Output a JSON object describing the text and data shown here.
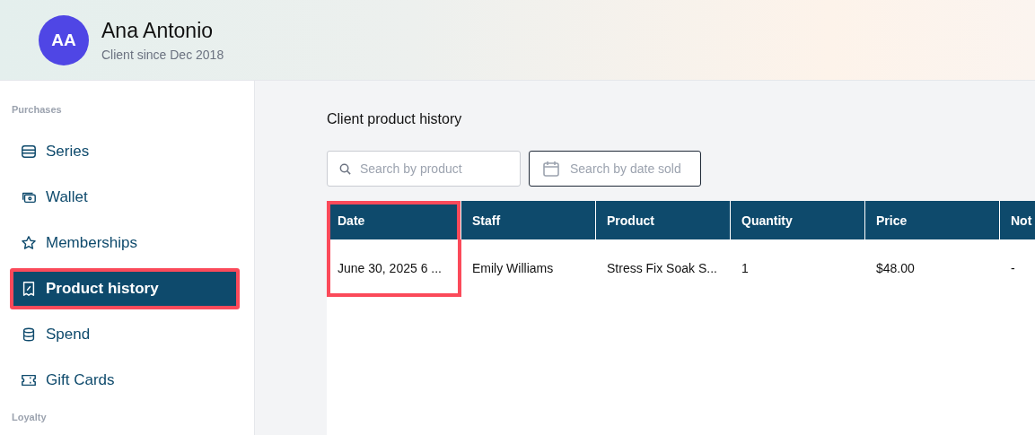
{
  "header": {
    "avatar_initials": "AA",
    "name": "Ana Antonio",
    "subtitle": "Client since Dec 2018"
  },
  "sidebar": {
    "sections": [
      {
        "title": "Purchases",
        "items": [
          {
            "label": "Series",
            "selected": false,
            "highlighted": false
          },
          {
            "label": "Wallet",
            "selected": false,
            "highlighted": false
          },
          {
            "label": "Memberships",
            "selected": false,
            "highlighted": false
          },
          {
            "label": "Product history",
            "selected": true,
            "highlighted": true
          },
          {
            "label": "Spend",
            "selected": false,
            "highlighted": false
          },
          {
            "label": "Gift Cards",
            "selected": false,
            "highlighted": false
          }
        ]
      },
      {
        "title": "Loyalty"
      }
    ]
  },
  "main": {
    "title": "Client product history",
    "search": {
      "placeholder": "Search by product"
    },
    "date_filter": {
      "placeholder": "Search by date sold"
    },
    "table": {
      "columns": [
        {
          "label": "Date",
          "highlighted": true
        },
        {
          "label": "Staff",
          "highlighted": false
        },
        {
          "label": "Product",
          "highlighted": false
        },
        {
          "label": "Quantity",
          "highlighted": false
        },
        {
          "label": "Price",
          "highlighted": false
        },
        {
          "label": "Not",
          "highlighted": false
        }
      ],
      "rows": [
        [
          "June 30, 2025 6 ...",
          "Emily Williams",
          "Stress Fix Soak S...",
          "1",
          "$48.00",
          "-"
        ]
      ]
    }
  }
}
